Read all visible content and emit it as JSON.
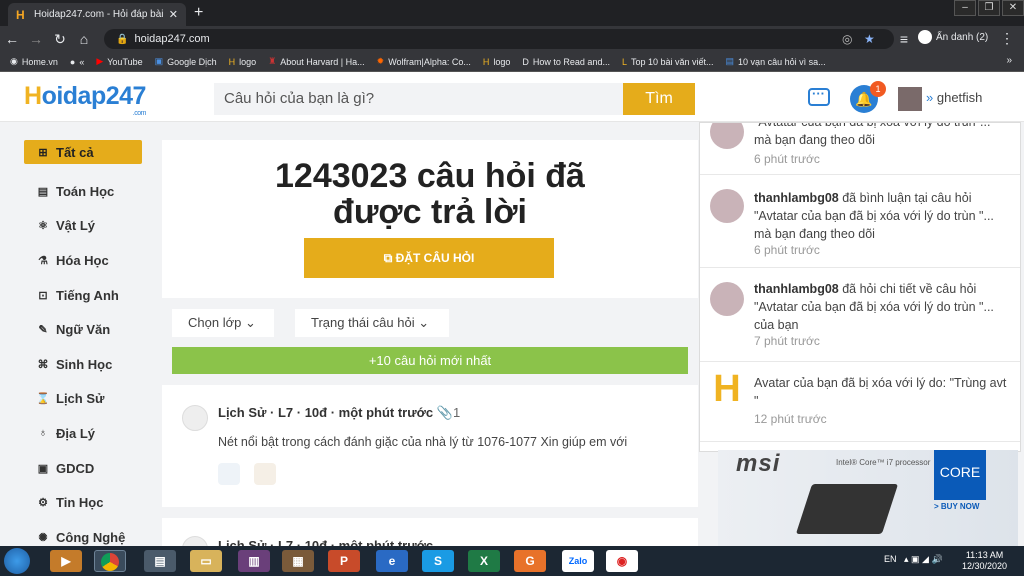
{
  "browser": {
    "tab_title": "Hoidap247.com - Hỏi đáp bài tập",
    "url": "hoidap247.com",
    "profile": "Ẩn danh (2)",
    "bookmarks": [
      "Home.vn",
      "«",
      "YouTube",
      "Google Dịch",
      "logo",
      "About Harvard | Ha...",
      "Wolfram|Alpha: Co...",
      "logo",
      "How to Read and...",
      "Top 10 bài văn viết...",
      "10 vạn câu hỏi vì sa..."
    ],
    "bookmarks_more": "»"
  },
  "header": {
    "logo_h": "H",
    "logo_rest": "oidap247",
    "logo_com": ".com",
    "search_placeholder": "Câu hỏi của bạn là gì?",
    "search_button": "Tìm",
    "notif_count": "1",
    "username": "ghetfish",
    "user_prefix": "»"
  },
  "sidebar": {
    "items": [
      {
        "label": "Tất cả",
        "icon": "⊞"
      },
      {
        "label": "Toán Học",
        "icon": "▤"
      },
      {
        "label": "Vật Lý",
        "icon": "⚛"
      },
      {
        "label": "Hóa Học",
        "icon": "⚗"
      },
      {
        "label": "Tiếng Anh",
        "icon": "⊡"
      },
      {
        "label": "Ngữ Văn",
        "icon": "✎"
      },
      {
        "label": "Sinh Học",
        "icon": "⌘"
      },
      {
        "label": "Lịch Sử",
        "icon": "⌛"
      },
      {
        "label": "Địa Lý",
        "icon": "♁"
      },
      {
        "label": "GDCD",
        "icon": "▣"
      },
      {
        "label": "Tin Học",
        "icon": "⚙"
      },
      {
        "label": "Công Nghệ",
        "icon": "✺"
      }
    ]
  },
  "hero": {
    "title_line1": "1243023 câu hỏi đã",
    "title_line2": "được trả lời",
    "ask_button": "ĐẶT CÂU HỎI"
  },
  "filters": {
    "grade": "Chọn lớp",
    "status": "Trạng thái câu hỏi",
    "new_questions": "+10 câu hỏi mới nhất"
  },
  "questions": [
    {
      "meta": "Lịch Sử · L7 · 10đ · một phút trước",
      "attach": "1",
      "text": "Nét nổi bật trong cách đánh giặc của nhà lý từ 1076-1077 Xin giúp em với"
    },
    {
      "meta": "Lịch Sử · L7 · 10đ · một phút trước",
      "attach": "",
      "text": ""
    }
  ],
  "notifications": [
    {
      "user": "",
      "action": "",
      "line1": "\"Avtatar của bạn đã bị xóa với lý do trùn\"...",
      "line2": "mà bạn đang theo dõi",
      "time": "6 phút trước"
    },
    {
      "user": "thanhlambg08",
      "action": " đã bình luận tại câu hỏi",
      "line1": "\"Avtatar của bạn đã bị xóa với lý do trùn \"...",
      "line2": "mà bạn đang theo dõi",
      "time": "6 phút trước"
    },
    {
      "user": "thanhlambg08",
      "action": " đã hỏi chi tiết về câu hỏi",
      "line1": "\"Avtatar của bạn đã bị xóa với lý do trùn \"...",
      "line2": "của bạn",
      "time": "7 phút trước"
    },
    {
      "user": "",
      "action": "",
      "line1": "Avatar của bạn đã bị xóa với lý do: \"Trùng avt",
      "line2": "\"",
      "time": "12 phút trước"
    }
  ],
  "ad": {
    "brand": "msi",
    "sub": "Intel® Core™ i7 processor",
    "intel": "CORE",
    "buy": "> BUY NOW"
  },
  "taskbar": {
    "lang": "EN",
    "time": "11:13 AM",
    "date": "12/30/2020"
  }
}
